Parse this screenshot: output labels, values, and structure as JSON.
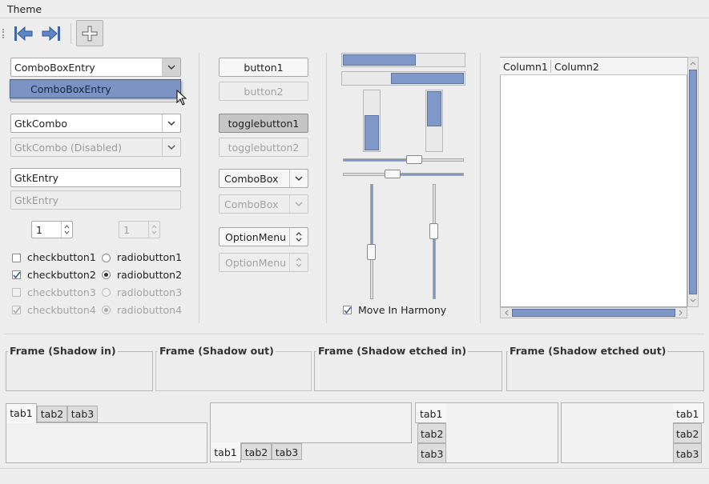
{
  "menubar": {
    "theme": "Theme"
  },
  "toolbar": {
    "first": "go-first-icon",
    "last": "go-last-icon",
    "add": "add-icon"
  },
  "col1": {
    "combo_entry": "ComboBoxEntry",
    "combo_popup_item": "ComboBoxEntry",
    "gtk_combo": "GtkCombo",
    "gtk_combo_disabled": "GtkCombo (Disabled)",
    "gtk_entry": "GtkEntry",
    "gtk_entry_disabled": "GtkEntry",
    "spin1": "1",
    "spin2": "1",
    "checkbuttons": [
      "checkbutton1",
      "checkbutton2",
      "checkbutton3",
      "checkbutton4"
    ],
    "radiobuttons": [
      "radiobutton1",
      "radiobutton2",
      "radiobutton3",
      "radiobutton4"
    ]
  },
  "col2": {
    "button1": "button1",
    "button2": "button2",
    "toggle1": "togglebutton1",
    "toggle2": "togglebutton2",
    "combobox": "ComboBox",
    "combobox_disabled": "ComboBox",
    "optionmenu": "OptionMenu",
    "optionmenu_disabled": "OptionMenu"
  },
  "col3": {
    "progress": {
      "h1": 0.6,
      "h2": 0.6,
      "v1": 0.6,
      "v2": 0.6
    },
    "move_in_harmony": "Move In Harmony"
  },
  "tree": {
    "columns": [
      "Column1",
      "Column2"
    ]
  },
  "frames": [
    "Frame (Shadow in)",
    "Frame (Shadow out)",
    "Frame (Shadow etched in)",
    "Frame (Shadow etched out)"
  ],
  "tabs": [
    "tab1",
    "tab2",
    "tab3"
  ],
  "colors": {
    "accent": "#7f98c8",
    "accent_border": "#5b74a4"
  }
}
